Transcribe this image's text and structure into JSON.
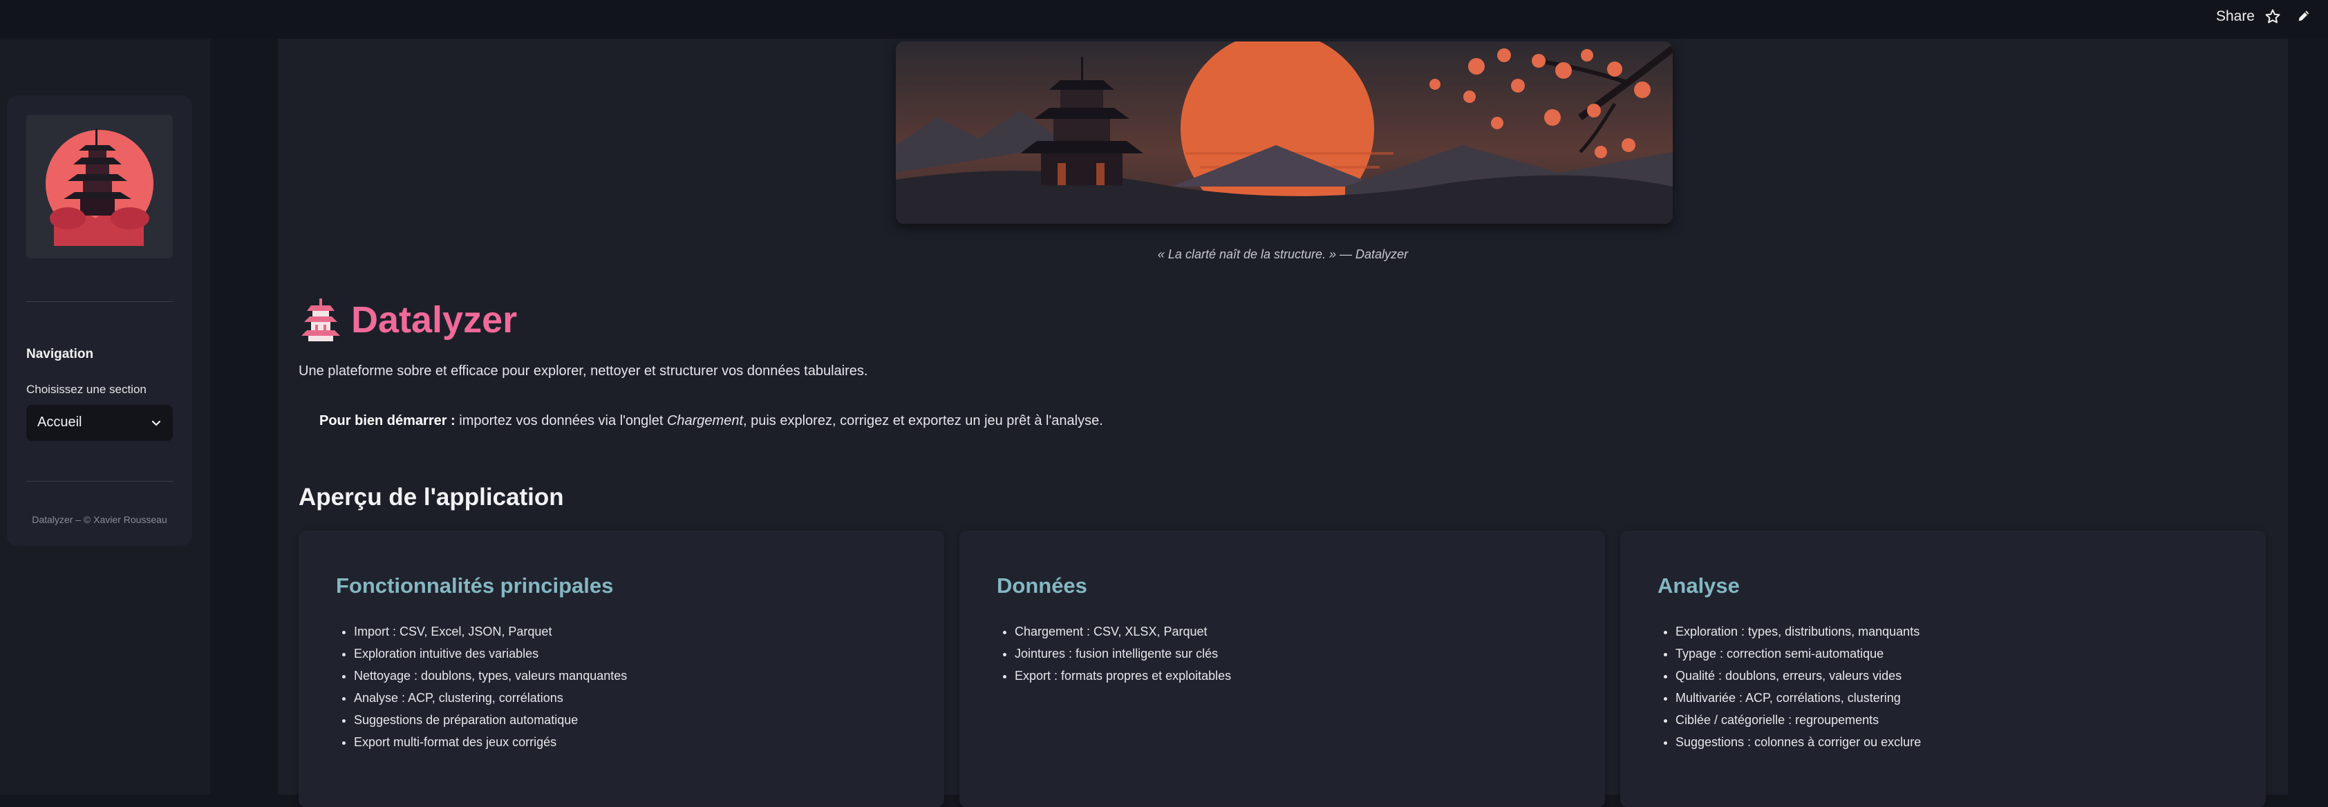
{
  "header": {
    "share_label": "Share",
    "icons": [
      "star-icon",
      "edit-icon"
    ]
  },
  "sidebar": {
    "logo": "pagoda-sunset-logo",
    "nav_title": "Navigation",
    "nav_label": "Choisissez une section",
    "nav_selected": "Accueil",
    "footer": "Datalyzer – © Xavier Rousseau"
  },
  "main": {
    "banner": "pagoda-sunset-banner",
    "caption": "« La clarté naît de la structure. » — Datalyzer",
    "title_icon": "pagoda-icon",
    "title": "Datalyzer",
    "subtitle": "Une plateforme sobre et efficace pour explorer, nettoyer et structurer vos données tabulaires.",
    "hint": {
      "bold": "Pour bien démarrer :",
      "pre": " importez vos données via l'onglet ",
      "em": "Chargement",
      "post": ", puis explorez, corrigez et exportez un jeu prêt à l'analyse."
    },
    "section_title": "Aperçu de l'application",
    "cards": [
      {
        "title": "Fonctionnalités principales",
        "items": [
          "Import : CSV, Excel, JSON, Parquet",
          "Exploration intuitive des variables",
          "Nettoyage : doublons, types, valeurs manquantes",
          "Analyse : ACP, clustering, corrélations",
          "Suggestions de préparation automatique",
          "Export multi-format des jeux corrigés"
        ]
      },
      {
        "title": "Données",
        "items": [
          "Chargement : CSV, XLSX, Parquet",
          "Jointures : fusion intelligente sur clés",
          "Export : formats propres et exploitables"
        ]
      },
      {
        "title": "Analyse",
        "items": [
          "Exploration : types, distributions, manquants",
          "Typage : correction semi-automatique",
          "Qualité : doublons, erreurs, valeurs vides",
          "Multivariée : ACP, corrélations, clustering",
          "Ciblée / catégorielle : regroupements",
          "Suggestions : colonnes à corriger ou exclure"
        ]
      }
    ]
  },
  "colors": {
    "background": "#14161d",
    "main_bg": "#1c1f28",
    "title_pink": "#f06a9a",
    "card_title_teal": "#84b8c2",
    "sun_orange": "#e0643a"
  }
}
